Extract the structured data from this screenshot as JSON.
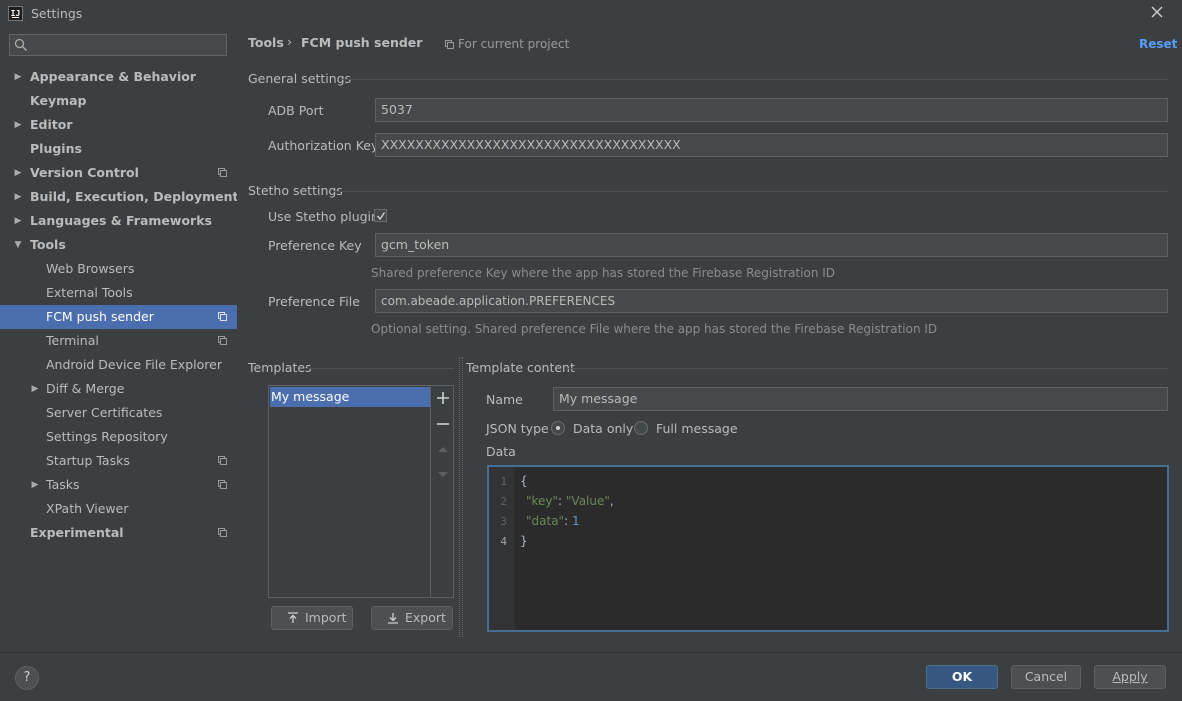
{
  "window": {
    "title": "Settings",
    "app_icon": "IJ"
  },
  "search": {
    "placeholder": ""
  },
  "sidebar": {
    "items": [
      {
        "label": "Appearance & Behavior",
        "arrow": "▶"
      },
      {
        "label": "Keymap"
      },
      {
        "label": "Editor",
        "arrow": "▶"
      },
      {
        "label": "Plugins"
      },
      {
        "label": "Version Control",
        "arrow": "▶"
      },
      {
        "label": "Build, Execution, Deployment",
        "arrow": "▶"
      },
      {
        "label": "Languages & Frameworks",
        "arrow": "▶"
      },
      {
        "label": "Tools",
        "arrow": "▼"
      },
      {
        "label": "Web Browsers"
      },
      {
        "label": "External Tools"
      },
      {
        "label": "FCM push sender"
      },
      {
        "label": "Terminal"
      },
      {
        "label": "Android Device File Explorer"
      },
      {
        "label": "Diff & Merge",
        "arrow": "▶"
      },
      {
        "label": "Server Certificates"
      },
      {
        "label": "Settings Repository"
      },
      {
        "label": "Startup Tasks"
      },
      {
        "label": "Tasks",
        "arrow": "▶"
      },
      {
        "label": "XPath Viewer"
      },
      {
        "label": "Experimental"
      }
    ]
  },
  "breadcrumb": {
    "parent": "Tools",
    "separator": "›",
    "current": "FCM push sender",
    "scope": "For current project"
  },
  "reset_label": "Reset",
  "general": {
    "section": "General settings",
    "adb_port_label": "ADB Port",
    "adb_port_value": "5037",
    "auth_key_label": "Authorization Key",
    "auth_key_value": "XXXXXXXXXXXXXXXXXXXXXXXXXXXXXXXXXXX"
  },
  "stetho": {
    "section": "Stetho settings",
    "use_plugin_label": "Use Stetho plugin",
    "use_plugin_checked": true,
    "pref_key_label": "Preference Key",
    "pref_key_value": "gcm_token",
    "pref_key_hint": "Shared preference Key where the app has stored the Firebase Registration ID",
    "pref_file_label": "Preference File",
    "pref_file_value": "com.abeade.application.PREFERENCES",
    "pref_file_hint": "Optional setting. Shared preference File where the app has stored the Firebase Registration ID"
  },
  "templates": {
    "section": "Templates",
    "items": [
      "My message"
    ],
    "import_label": "Import",
    "export_label": "Export"
  },
  "template_content": {
    "section": "Template content",
    "name_label": "Name",
    "name_value": "My message",
    "json_type_label": "JSON type",
    "option_data_only": "Data only",
    "option_full_message": "Full message",
    "selected_option": "Data only",
    "data_label": "Data",
    "line_numbers": [
      "1",
      "2",
      "3",
      "4"
    ],
    "code": {
      "l1": "{",
      "l2_key": "\"key\"",
      "l2_colon": ": ",
      "l2_value": "\"Value\"",
      "l2_comma": ",",
      "l3_key": "\"data\"",
      "l3_colon": ": ",
      "l3_value": "1",
      "l4": "}"
    }
  },
  "footer": {
    "help": "?",
    "ok": "OK",
    "cancel": "Cancel",
    "apply": "Apply"
  }
}
